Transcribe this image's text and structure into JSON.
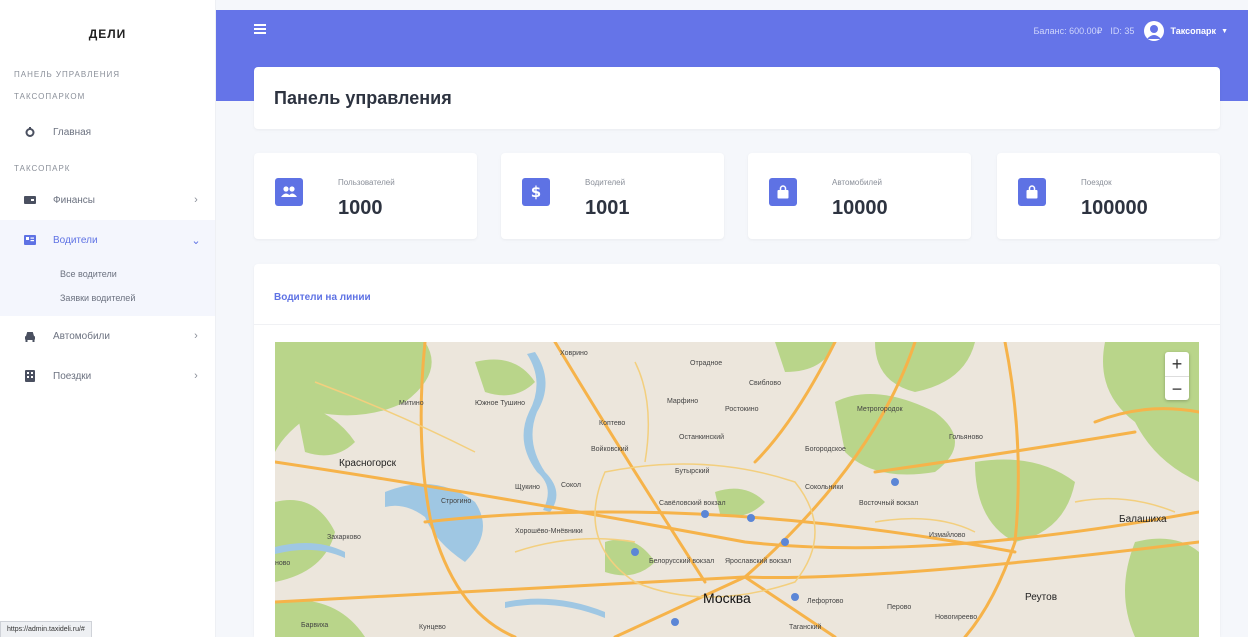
{
  "sidebar": {
    "brand": "ДЕЛИ",
    "section1_line1": "ПАНЕЛЬ УПРАВЛЕНИЯ",
    "section1_line2": "ТАКСОПАРКОМ",
    "home": "Главная",
    "section2": "ТАКСОПАРК",
    "finances": "Финансы",
    "drivers": "Водители",
    "all_drivers": "Все водители",
    "driver_orders": "Заявки водителей",
    "cars": "Автомобили",
    "trips": "Поездки"
  },
  "topbar": {
    "balance": "Баланс: 600.00₽",
    "id": "ID: 35",
    "user": "Таксопарк"
  },
  "header": {
    "title": "Панель управления"
  },
  "stats": [
    {
      "label": "Пользователей",
      "value": "1000",
      "icon": "users-icon"
    },
    {
      "label": "Водителей",
      "value": "1001",
      "icon": "dollar-icon"
    },
    {
      "label": "Автомобилей",
      "value": "10000",
      "icon": "bag-icon"
    },
    {
      "label": "Поездок",
      "value": "100000",
      "icon": "bag-icon"
    }
  ],
  "map": {
    "title": "Водители на линии",
    "zoom_in": "+",
    "zoom_out": "−",
    "places": {
      "khovrino": "Ховрино",
      "otradnoe": "Отрадное",
      "sviblovo": "Свиблово",
      "mitino": "Митино",
      "yuzhnoe_tushino": "Южное Тушино",
      "marfino": "Марфино",
      "rostokino": "Ростокино",
      "metrogorodok": "Метрогородок",
      "koptevo": "Коптево",
      "ostankinsky": "Останкинский",
      "golyanovo": "Гольяново",
      "voykovsky": "Войковский",
      "bogorodskoe": "Богородское",
      "krasnogorsk": "Красногорск",
      "butyrsky": "Бутырский",
      "shchukino": "Щукино",
      "sokol": "Сокол",
      "sokolniki": "Сокольники",
      "strogino": "Строгино",
      "savyolovsky": "Савёловский вокзал",
      "vostochny": "Восточный вокзал",
      "balashikha": "Балашиха",
      "zakharkovo": "Захарково",
      "khoroshevo": "Хорошёво-Мнёвники",
      "izmaylovo": "Измайлово",
      "belorussky": "Белорусский вокзал",
      "yaroslavsky": "Ярославский вокзал",
      "novo": "ново",
      "moskva": "Москва",
      "lefortovo": "Лефортово",
      "perovo": "Перово",
      "reutov": "Реутов",
      "novogireevo": "Новогиреево",
      "barvikha": "Барвиха",
      "kuntsevo": "Кунцево",
      "taganskiy": "Таганский"
    }
  },
  "status_url": "https://admin.taxideli.ru/#",
  "colors": {
    "accent": "#5e72e4",
    "topbar": "#6574e8"
  }
}
